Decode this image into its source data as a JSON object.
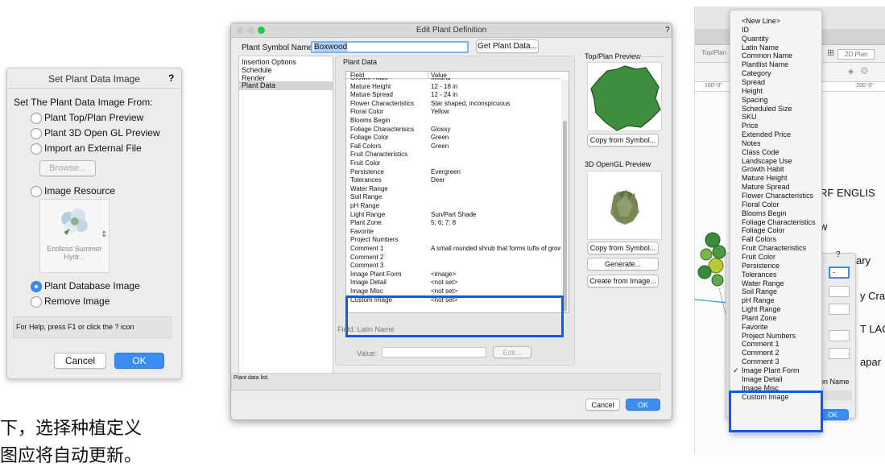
{
  "caption": {
    "line1": "下，选择种植定义",
    "line2": "图应将自动更新。"
  },
  "set_image_dialog": {
    "title": "Set Plant Data Image",
    "help_mark": "?",
    "heading": "Set The Plant Data Image From:",
    "options": [
      {
        "label": "Plant Top/Plan Preview",
        "selected": false
      },
      {
        "label": "Plant 3D Open GL Preview",
        "selected": false
      },
      {
        "label": "Import an External File",
        "selected": false
      },
      {
        "label": "Image Resource",
        "selected": false
      },
      {
        "label": "Plant Database Image",
        "selected": true
      },
      {
        "label": "Remove Image",
        "selected": false
      }
    ],
    "browse_label": "Browse...",
    "resource_name": "Endless Summer Hydr...",
    "help_text": "For Help, press F1 or click the ? icon",
    "cancel_label": "Cancel",
    "ok_label": "OK"
  },
  "edit_dialog": {
    "title": "Edit Plant Definition",
    "help_mark": "?",
    "symbol_name_label": "Plant Symbol Name:",
    "symbol_name_value": "Boxwood",
    "get_plant_data_label": "Get Plant Data...",
    "nav_items": [
      "Insertion Options",
      "Schedule",
      "Render",
      "Plant Data"
    ],
    "section_title": "Plant Data",
    "columns": [
      "Field",
      "Value"
    ],
    "rows": [
      {
        "field": "Growth Habit",
        "value": "Mound"
      },
      {
        "field": "Mature Height",
        "value": "12 - 18 in"
      },
      {
        "field": "Mature Spread",
        "value": "12 - 24 in"
      },
      {
        "field": "Flower Characteristics",
        "value": "Star shaped, inconspicuous"
      },
      {
        "field": "Floral Color",
        "value": "Yellow"
      },
      {
        "field": "Blooms Begin",
        "value": ""
      },
      {
        "field": "Foliage Characterisics",
        "value": "Glossy"
      },
      {
        "field": "Foliage Color",
        "value": "Green"
      },
      {
        "field": "Fall Colors",
        "value": "Green"
      },
      {
        "field": "Fruit Characteristics",
        "value": ""
      },
      {
        "field": "Fruit Color",
        "value": ""
      },
      {
        "field": "Persistence",
        "value": "Evergreen"
      },
      {
        "field": "Tolerances",
        "value": "Deer"
      },
      {
        "field": "Water Range",
        "value": ""
      },
      {
        "field": "Soil Range",
        "value": ""
      },
      {
        "field": "pH Range",
        "value": ""
      },
      {
        "field": "Light Range",
        "value": "Sun/Part Shade"
      },
      {
        "field": "Plant Zone",
        "value": "5; 6; 7; 8"
      },
      {
        "field": "Favorite",
        "value": ""
      },
      {
        "field": "Project Numbers",
        "value": ""
      },
      {
        "field": "Comment 1",
        "value": "A small rounded shrub that forms tufts of growth"
      },
      {
        "field": "Comment 2",
        "value": ""
      },
      {
        "field": "Comment 3",
        "value": ""
      },
      {
        "field": "Image Plant Form",
        "value": "<image>"
      },
      {
        "field": "Image Detail",
        "value": "<not set>"
      },
      {
        "field": "Image Misc",
        "value": "<not set>"
      },
      {
        "field": "Custom Image",
        "value": "<not set>"
      }
    ],
    "field_label": "Field:  Latin Name",
    "value_label": "Value:",
    "edit_label": "Edit...",
    "top_plan_preview_label": "Top/Plan Preview",
    "copy_from_symbol_1": "Copy from Symbol...",
    "opengl_preview_label": "3D OpenGL Preview",
    "copy_from_symbol_2": "Copy from Symbol...",
    "generate_label": "Generate...",
    "create_from_image_label": "Create from Image...",
    "status_text": "Plant data list.",
    "cancel_label": "Cancel",
    "ok_label": "OK"
  },
  "background_app": {
    "toolbar_labels": [
      "Top/Plan",
      "2D Plan"
    ],
    "ruler_labels": [
      "160'-0\"",
      "200'-0\""
    ],
    "drawing_texts": [
      "RF ENGLIS",
      "w",
      "ary",
      "y Cra",
      "T LAC",
      "apar"
    ],
    "mini_dialog_help": "?",
    "mini_dialog_field_value": "-",
    "mini_dialog_label": "on Name",
    "mini_dialog_ok": "OK"
  },
  "dropdown_menu": {
    "items": [
      "<New Line>",
      "ID",
      "Quantity",
      "Latin Name",
      "Common Name",
      "Plantlist Name",
      "Category",
      "Spread",
      "Height",
      "Spacing",
      "Scheduled Size",
      "SKU",
      "Price",
      "Extended Price",
      "Notes",
      "Class Code",
      "Landscape Use",
      "Growth Habit",
      "Mature Height",
      "Mature Spread",
      "Flower Characteristics",
      "Floral Color",
      "Blooms Begin",
      "Foliage Characteristics",
      "Foliage Color",
      "Fall Colors",
      "Fruit Characteristics",
      "Fruit Color",
      "Persistence",
      "Tolerances",
      "Water Range",
      "Soil Range",
      "pH Range",
      "Light Range",
      "Plant Zone",
      "Favorite",
      "Project Numbers",
      "Comment 1",
      "Comment 2",
      "Comment 3",
      "Image Plant Form",
      "Image Detail",
      "Image Misc",
      "Custom Image"
    ],
    "checked_item": "Image Plant Form",
    "check_mark": "✓"
  },
  "colors": {
    "highlight_box": "#0a5cf0",
    "accent_blue": "#3b8df1",
    "dialog_bg": "#ececec"
  }
}
